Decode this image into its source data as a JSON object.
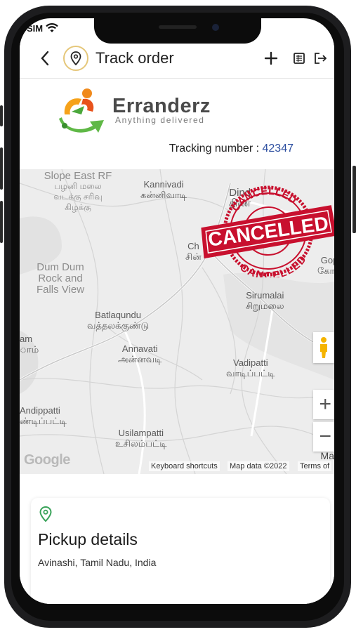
{
  "status_bar": {
    "carrier": "SIM",
    "wifi_icon": "wifi-icon"
  },
  "header": {
    "title": "Track order",
    "icons": [
      "chevron-left-icon",
      "location-pin-icon",
      "plus-icon",
      "receipt-icon",
      "logout-icon"
    ]
  },
  "brand": {
    "name": "Erranderz",
    "tagline": "Anything delivered"
  },
  "tracking": {
    "label": "Tracking number :",
    "number": "42347"
  },
  "map": {
    "places": [
      {
        "id": "slope",
        "en": "Slope East RF",
        "ta": "பழனி மலை வடக்கு சரிவு கிழக்கு"
      },
      {
        "id": "kannivadi",
        "en": "Kannivadi",
        "ta": "கன்னிவாடி"
      },
      {
        "id": "dindigul",
        "en": "Dind",
        "ta": "திண்"
      },
      {
        "id": "chinna",
        "en": "Ch",
        "ta": "சின்"
      },
      {
        "id": "gop",
        "en": "Gop",
        "ta": "கோப"
      },
      {
        "id": "dumdum",
        "en": "Dum Dum Rock and Falls View",
        "ta": ""
      },
      {
        "id": "sirumalai",
        "en": "Sirumalai",
        "ta": "சிறுமலை"
      },
      {
        "id": "batlagundu",
        "en": "Batlaqundu",
        "ta": "வத்தலக்குண்டு"
      },
      {
        "id": "am",
        "en": "am",
        "ta": "ாம்"
      },
      {
        "id": "annavati",
        "en": "Annavati",
        "ta": "அன்னவடி"
      },
      {
        "id": "vadipatti",
        "en": "Vadipatti",
        "ta": "வாடிப்பட்டி"
      },
      {
        "id": "andippatti",
        "en": "Andippatti",
        "ta": "ண்டிப்பட்டி"
      },
      {
        "id": "usilampatti",
        "en": "Usilampatti",
        "ta": "உசிலம்பட்டி"
      }
    ],
    "google": "Google",
    "shortcuts": "Keyboard shortcuts",
    "map_data": "Map data ©2022",
    "terms": "Terms of",
    "zoom_in": "+",
    "zoom_out": "−",
    "stamp_text": "CANCELLED",
    "stamp_ring_top": "CANCELLED",
    "stamp_ring_bottom": "CANCELLED",
    "ma_label": "Ma"
  },
  "pickup": {
    "title": "Pickup details",
    "address": "Avinashi, Tamil Nadu, India"
  },
  "colors": {
    "accent": "#2c4ea0",
    "stamp_red": "#c8102e",
    "pin_green": "#3aa35a",
    "brand_orange": "#f08a1c",
    "brand_green": "#5fb846"
  }
}
